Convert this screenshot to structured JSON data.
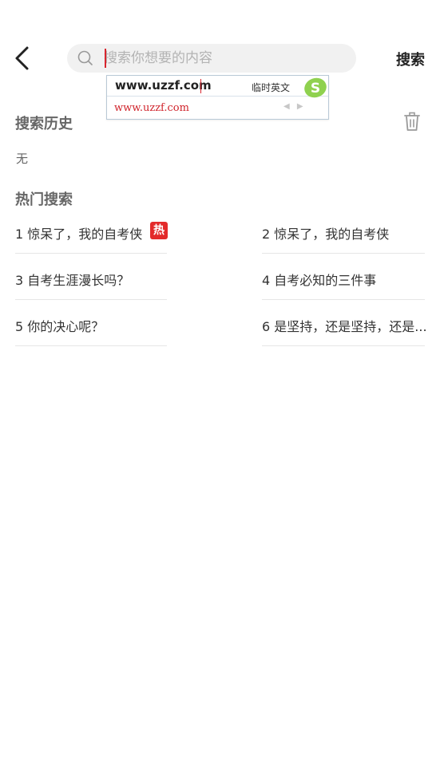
{
  "header": {
    "search_placeholder": "搜索你想要的内容",
    "search_button": "搜索"
  },
  "ime": {
    "input_text": "www.uzzf.com",
    "mode_label": "临时英文",
    "candidate": "www.uzzf.com",
    "arrows": "◀ ▶"
  },
  "history": {
    "title": "搜索历史",
    "empty_text": "无"
  },
  "hot": {
    "title": "热门搜索",
    "badge": "热",
    "items": [
      "1 惊呆了，我的自考侠",
      "2 惊呆了，我的自考侠",
      "3 自考生涯漫长吗？",
      "4 自考必知的三件事",
      "5 你的决心呢？",
      "6 是坚持，还是坚持，还是..."
    ]
  },
  "colors": {
    "accent_red": "#e32a2a",
    "caret_red": "#d8262f",
    "search_bg": "#f1f1f1"
  }
}
